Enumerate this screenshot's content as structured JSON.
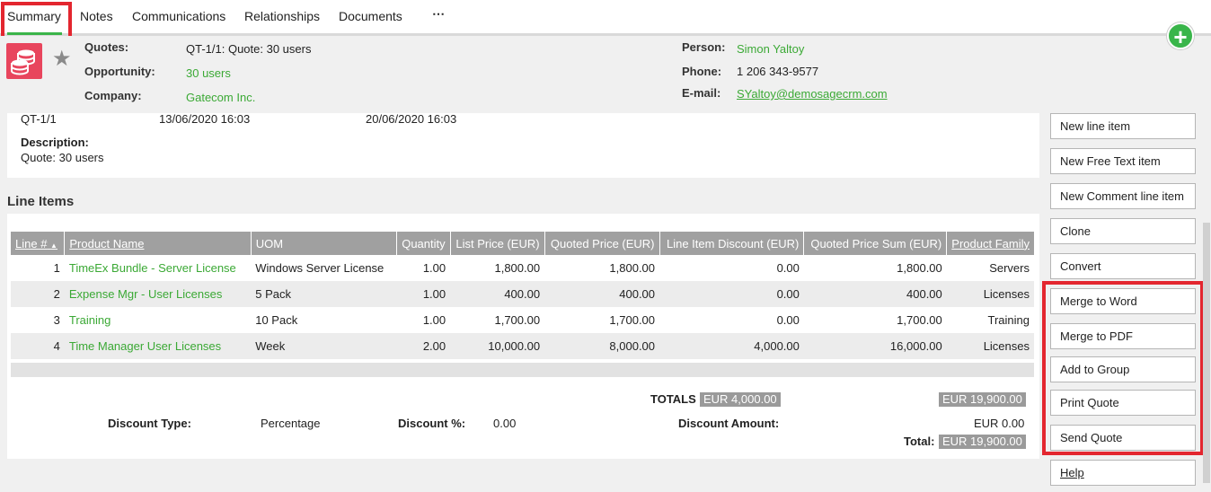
{
  "tabs": [
    "Summary",
    "Notes",
    "Communications",
    "Relationships",
    "Documents",
    "⋯"
  ],
  "header": {
    "quotes_label": "Quotes:",
    "quotes_value": "QT-1/1: Quote: 30 users",
    "opportunity_label": "Opportunity:",
    "opportunity_value": "30 users",
    "company_label": "Company:",
    "company_value": "Gatecom Inc.",
    "person_label": "Person:",
    "person_value": "Simon Yaltoy",
    "phone_label": "Phone:",
    "phone_value": "1 206 343-9577",
    "email_label": "E-mail:",
    "email_value": "SYaltoy@demosagecrm.com"
  },
  "quote": {
    "id": "QT-1/1",
    "date1": "13/06/2020 16:03",
    "date2": "20/06/2020 16:03",
    "description_label": "Description:",
    "description_value": "Quote: 30 users"
  },
  "line_items": {
    "title": "Line Items",
    "columns": [
      "Line #",
      "Product Name",
      "UOM",
      "Quantity",
      "List Price (EUR)",
      "Quoted Price (EUR)",
      "Line Item Discount (EUR)",
      "Quoted Price Sum (EUR)",
      "Product Family"
    ],
    "rows": [
      [
        "1",
        "TimeEx Bundle - Server License",
        "Windows Server License",
        "1.00",
        "1,800.00",
        "1,800.00",
        "0.00",
        "1,800.00",
        "Servers"
      ],
      [
        "2",
        "Expense Mgr - User Licenses",
        "5 Pack",
        "1.00",
        "400.00",
        "400.00",
        "0.00",
        "400.00",
        "Licenses"
      ],
      [
        "3",
        "Training",
        "10 Pack",
        "1.00",
        "1,700.00",
        "1,700.00",
        "0.00",
        "1,700.00",
        "Training"
      ],
      [
        "4",
        "Time Manager User Licenses",
        "Week",
        "2.00",
        "10,000.00",
        "8,000.00",
        "4,000.00",
        "16,000.00",
        "Licenses"
      ]
    ]
  },
  "totals": {
    "totals_label": "TOTALS",
    "totals_discount": "EUR 4,000.00",
    "totals_sum": "EUR 19,900.00",
    "discount_type_label": "Discount Type:",
    "discount_type_value": "Percentage",
    "discount_pct_label": "Discount %:",
    "discount_pct_value": "0.00",
    "discount_amount_label": "Discount Amount:",
    "discount_amount_value": "EUR 0.00",
    "total_label": "Total:",
    "total_value": "EUR 19,900.00"
  },
  "actions": [
    "New line item",
    "New Free Text item",
    "New Comment line item",
    "Clone",
    "Convert",
    "Merge to Word",
    "Merge to PDF",
    "Add to Group",
    "Print Quote",
    "Send Quote",
    "Help"
  ],
  "colors": {
    "accent_green": "#3ba935",
    "highlight_red": "#e3262f",
    "header_grey": "#a0a0a0"
  },
  "icons": {
    "add": "plus-circle-icon",
    "quote": "coins-icon",
    "favorite": "star-icon"
  }
}
